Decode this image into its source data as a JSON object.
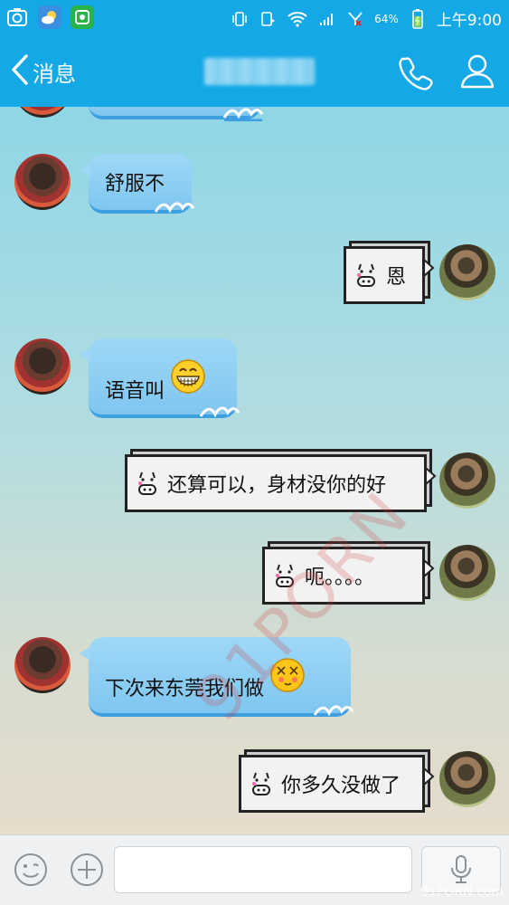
{
  "status_bar": {
    "battery_percent": "64%",
    "time": "上午9:00",
    "icons": [
      "camera-app-icon",
      "weather-app-icon",
      "green-app-icon",
      "vibrate-icon",
      "call-icon",
      "wifi-icon",
      "signal-icon",
      "sim2-signal-icon",
      "battery-icon"
    ]
  },
  "nav": {
    "back_label": "消息",
    "title": "",
    "phone_icon": "phone-icon",
    "profile_icon": "profile-icon"
  },
  "messages": [
    {
      "side": "left",
      "style": "blue",
      "text": "舒服不"
    },
    {
      "side": "right",
      "style": "pixel",
      "text": "恩"
    },
    {
      "side": "left",
      "style": "blue",
      "text": "语音叫",
      "emoji": "grin-emoji-icon"
    },
    {
      "side": "right",
      "style": "pixel",
      "text": "还算可以，身材没你的好"
    },
    {
      "side": "right",
      "style": "pixel",
      "text": "呃。。。。"
    },
    {
      "side": "left",
      "style": "blue",
      "text": "下次来东莞我们做",
      "emoji": "dizzy-emoji-icon"
    },
    {
      "side": "right",
      "style": "pixel",
      "text": "你多久没做了"
    }
  ],
  "watermark": "91PORN",
  "corner_watermark": "91PORN.com",
  "input": {
    "value": "",
    "placeholder": ""
  },
  "colors": {
    "accent": "#14a9e6",
    "bubble_blue": "#8fcff3",
    "bubble_pixel": "#f2f2f2"
  }
}
